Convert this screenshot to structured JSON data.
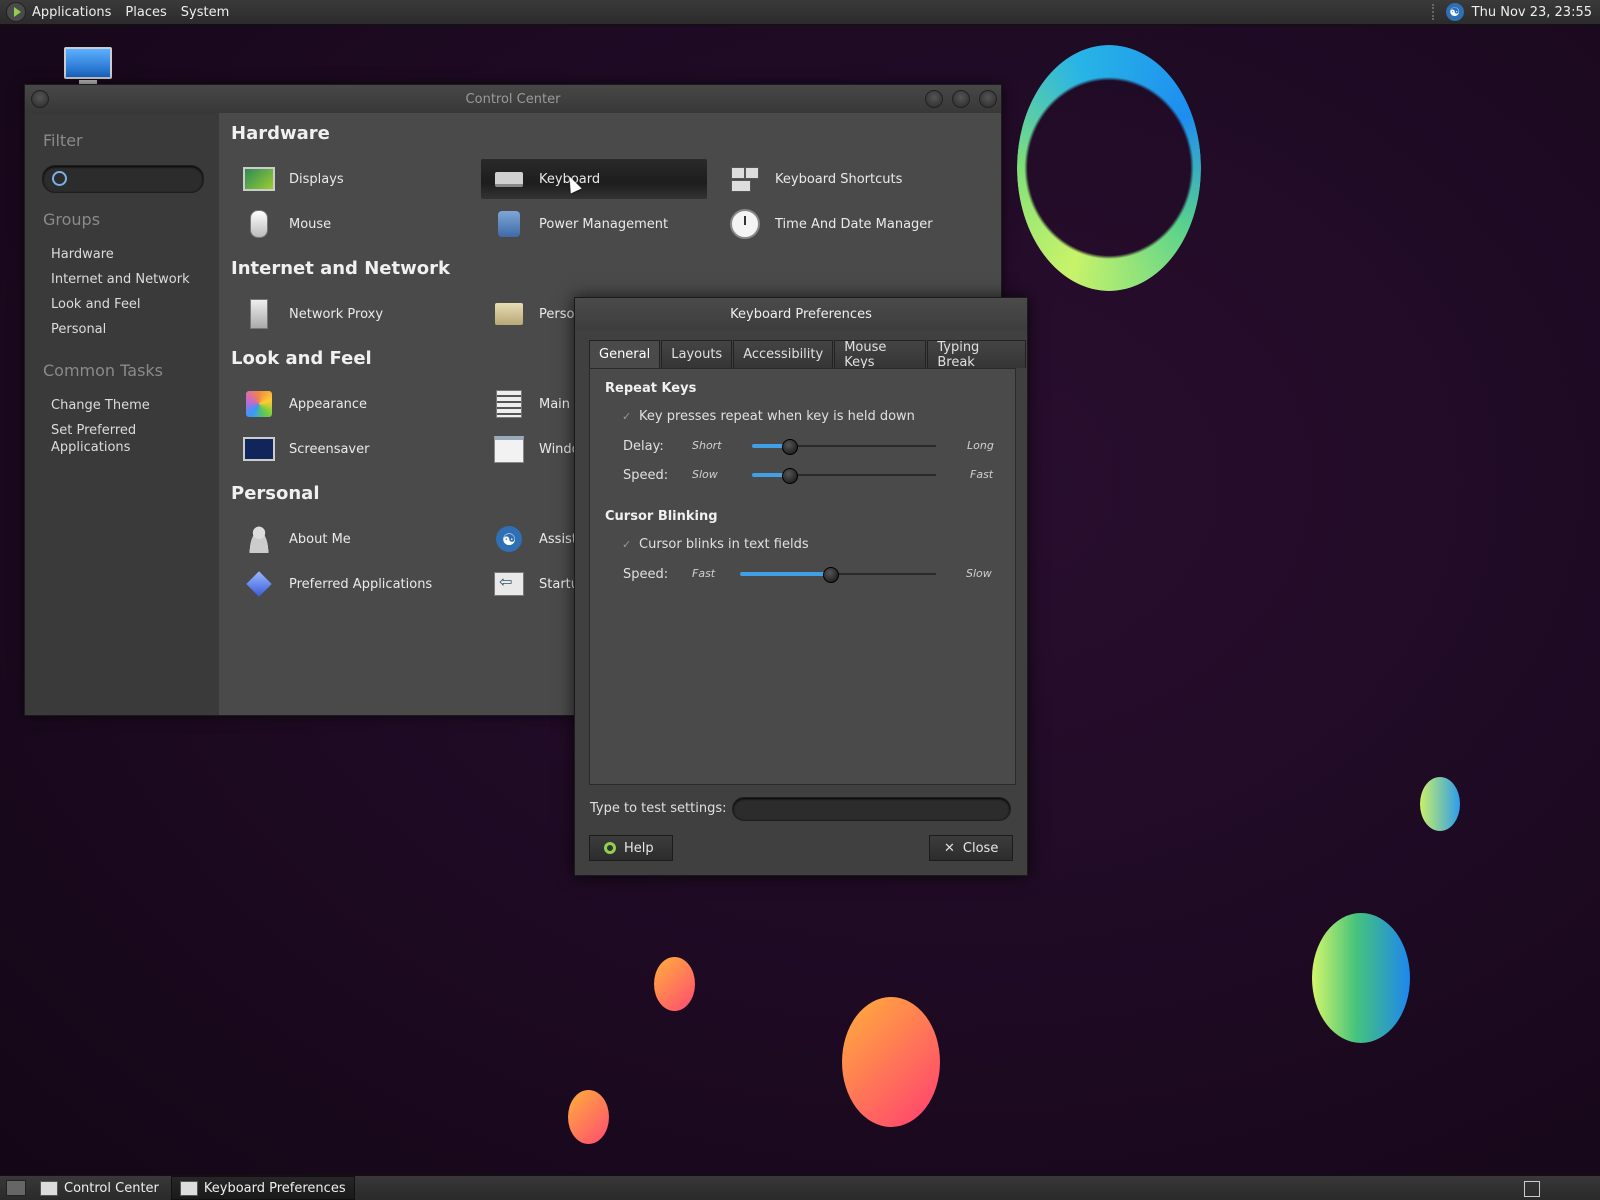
{
  "top_panel": {
    "menus": [
      "Applications",
      "Places",
      "System"
    ],
    "clock": "Thu Nov 23, 23:55"
  },
  "colors": {
    "accent": "#3fa0e6",
    "help_green": "#8fd14f",
    "background": "#1d0a22"
  },
  "control_center": {
    "title": "Control Center",
    "sidebar": {
      "filter_label": "Filter",
      "filter_value": "",
      "groups_label": "Groups",
      "groups": [
        "Hardware",
        "Internet and Network",
        "Look and Feel",
        "Personal"
      ],
      "common_tasks_label": "Common Tasks",
      "common_tasks": [
        "Change Theme",
        "Set Preferred Applications"
      ]
    },
    "sections": {
      "hardware": {
        "title": "Hardware",
        "items": [
          "Displays",
          "Keyboard",
          "Keyboard Shortcuts",
          "Mouse",
          "Power Management",
          "Time And Date Manager"
        ]
      },
      "internet": {
        "title": "Internet and Network",
        "items": [
          "Network Proxy",
          "Persona"
        ]
      },
      "look": {
        "title": "Look and Feel",
        "items": [
          "Appearance",
          "Main Me",
          "Screensaver",
          "Windov"
        ]
      },
      "personal": {
        "title": "Personal",
        "items": [
          "About Me",
          "Assistive",
          "Preferred Applications",
          "Startup"
        ]
      }
    },
    "selected_item": "Keyboard"
  },
  "keyboard_prefs": {
    "title": "Keyboard Preferences",
    "tabs": [
      "General",
      "Layouts",
      "Accessibility",
      "Mouse Keys",
      "Typing Break"
    ],
    "active_tab": "General",
    "repeat_keys": {
      "heading": "Repeat Keys",
      "checkbox_label": "Key presses repeat when key is held down",
      "checked": true,
      "delay_label": "Delay:",
      "delay_min": "Short",
      "delay_max": "Long",
      "delay_value": 0.2,
      "speed_label": "Speed:",
      "speed_min": "Slow",
      "speed_max": "Fast",
      "speed_value": 0.2
    },
    "cursor_blinking": {
      "heading": "Cursor Blinking",
      "checkbox_label": "Cursor blinks in text fields",
      "checked": true,
      "speed_label": "Speed:",
      "speed_min": "Fast",
      "speed_max": "Slow",
      "speed_value": 0.46
    },
    "test_label": "Type to test settings:",
    "test_value": "",
    "help_label": "Help",
    "close_label": "Close"
  },
  "taskbar": {
    "tasks": [
      "Control Center",
      "Keyboard Preferences"
    ],
    "active_task": "Keyboard Preferences"
  }
}
